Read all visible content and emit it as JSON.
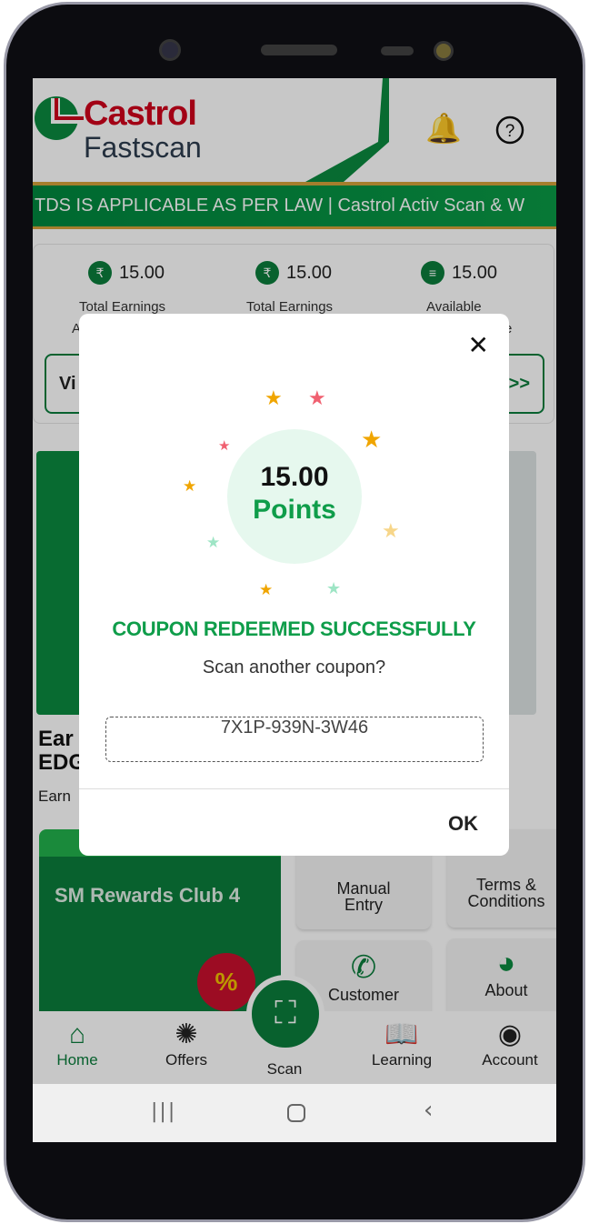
{
  "header": {
    "brand": "Castrol",
    "subtitle": "Fastscan",
    "bell_icon": "bell-icon",
    "help_icon": "help-circle-icon"
  },
  "ticker": "TDS IS APPLICABLE AS PER LAW | Castrol Activ Scan & W",
  "stats": [
    {
      "value": "15.00",
      "label": "Total Earnings",
      "icon": "rupee-icon"
    },
    {
      "value": "15.00",
      "label": "Total Earnings",
      "icon": "rupee-icon"
    },
    {
      "value": "15.00",
      "label": "Available",
      "icon": "coins-icon"
    }
  ],
  "stats_partial": {
    "left": "A",
    "right": "e"
  },
  "view_button_partial": "Vi",
  "view_arrow": ">>",
  "promo": {
    "title_line1": "Ear",
    "title_line2": "EDG",
    "subtitle": "Earn"
  },
  "rewards_card": {
    "title": "SM Rewards Club 4",
    "badge": "%"
  },
  "tiles": [
    {
      "label_line1": "Manual",
      "label_line2": "Entry"
    },
    {
      "label_line1": "Terms &",
      "label_line2": "Conditions"
    },
    {
      "label_line1": "Customer",
      "label_line2": ""
    },
    {
      "label_line1": "About",
      "label_line2": ""
    }
  ],
  "bottom_nav": [
    {
      "label": "Home",
      "icon": "home-icon",
      "active": true
    },
    {
      "label": "Offers",
      "icon": "offers-icon"
    },
    {
      "label": "Scan",
      "icon": "scan-icon"
    },
    {
      "label": "Learning",
      "icon": "learning-icon"
    },
    {
      "label": "Account",
      "icon": "account-icon"
    }
  ],
  "dialog": {
    "points_value": "15.00",
    "points_label": "Points",
    "title": "COUPON REDEEMED SUCCESSFULLY",
    "question": "Scan another coupon?",
    "coupon_code": "7X1P-939N-3W46",
    "ok_label": "OK",
    "close_icon": "close-icon"
  },
  "colors": {
    "brand_green": "#0b7d3c",
    "brand_red": "#d0021b",
    "success_green": "#0f9d4a",
    "ticker_border": "#d4a23a"
  }
}
